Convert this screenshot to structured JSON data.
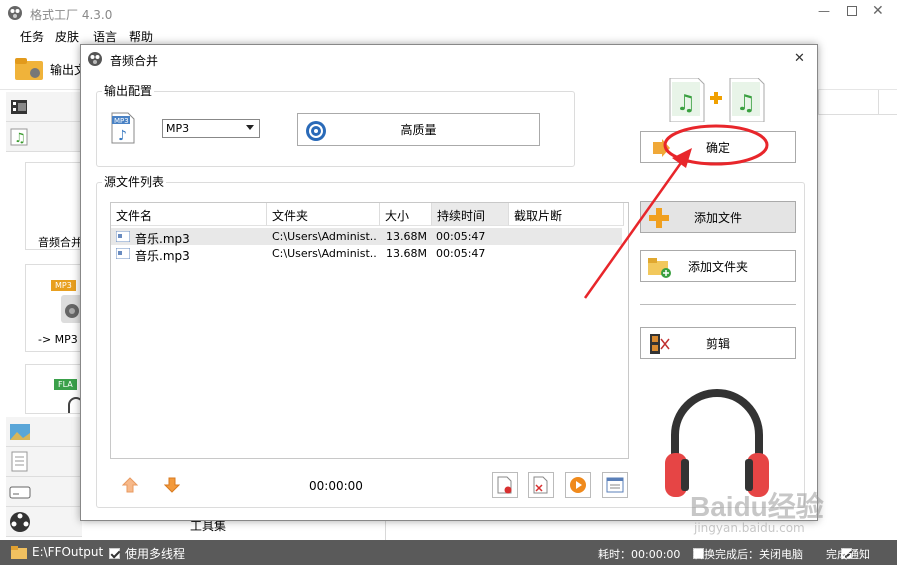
{
  "main": {
    "title": "格式工厂 4.3.0",
    "menu": [
      "任务",
      "皮肤",
      "语言",
      "帮助"
    ],
    "toolbar_label": "输出文",
    "tiles": [
      "音频合并",
      "-> MP3",
      ""
    ],
    "tile_badges": [
      "MP3",
      "FLA"
    ],
    "toolbox_label": "工具集"
  },
  "status": {
    "output_path": "E:\\FFOutput",
    "multithread_label": "使用多线程",
    "elapsed": "耗时：00:00:00",
    "after_done": "转换完成后：关闭电脑",
    "notify_label": "完成通知"
  },
  "dialog": {
    "title": "音频合并",
    "output_group": "输出配置",
    "format_value": "MP3",
    "quality_label": "高质量",
    "source_group": "源文件列表",
    "ok_label": "确定",
    "add_file_label": "添加文件",
    "add_folder_label": "添加文件夹",
    "clip_label": "剪辑",
    "time_total": "00:00:00",
    "columns": [
      "文件名",
      "文件夹",
      "大小",
      "持续时间",
      "截取片断"
    ],
    "rows": [
      {
        "name": "音乐.mp3",
        "folder": "C:\\Users\\Administ...",
        "size": "13.68M",
        "duration": "00:05:47",
        "clip": ""
      },
      {
        "name": "音乐.mp3",
        "folder": "C:\\Users\\Administ...",
        "size": "13.68M",
        "duration": "00:05:47",
        "clip": ""
      }
    ]
  },
  "watermark": {
    "brand": "Baidu经验",
    "url": "jingyan.baidu.com"
  },
  "colors": {
    "annotation_red": "#e8262b",
    "statusbar": "#5a5a5a",
    "selected_row": "#e8e8e8",
    "add_file_button": "#e4e4e4",
    "headphone_red": "#e64545"
  }
}
